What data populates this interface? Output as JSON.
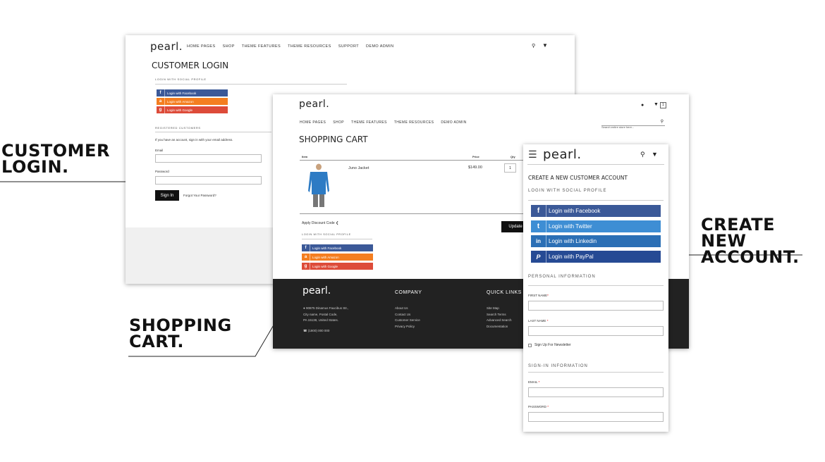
{
  "callouts": {
    "login": [
      "CUSTOMER",
      "LOGIN."
    ],
    "cart": [
      "SHOPPING",
      "CART."
    ],
    "account": [
      "CREATE NEW",
      "ACCOUNT."
    ]
  },
  "login_panel": {
    "logo": "pearl.",
    "nav": [
      "HOME PAGES",
      "SHOP",
      "THEME FEATURES",
      "THEME RESOURCES",
      "SUPPORT",
      "DEMO ADMIN"
    ],
    "title": "CUSTOMER LOGIN",
    "social_heading": "LOGIN WITH SOCIAL PROFILE",
    "social": [
      {
        "icon": "f",
        "label": "Login with Facebook"
      },
      {
        "icon": "a",
        "label": "Login with Amazon"
      },
      {
        "icon": "g",
        "label": "Login with Google"
      }
    ],
    "registered_heading": "REGISTERED CUSTOMERS",
    "registered_text": "If you have an account, sign in with your email address.",
    "email_label": "Email",
    "password_label": "Password",
    "sign_in": "Sign In",
    "forgot": "Forgot Your Password?"
  },
  "cart_panel": {
    "logo": "pearl.",
    "cart_count": "1",
    "nav": [
      "HOME PAGES",
      "SHOP",
      "THEME FEATURES",
      "THEME RESOURCES",
      "DEMO ADMIN"
    ],
    "search_placeholder": "Search entire store here...",
    "title": "SHOPPING CART",
    "col_item": "Item",
    "col_price": "Price",
    "col_qty": "Qty",
    "product_name": "Juno Jacket",
    "product_price": "$149.00",
    "product_qty": "1",
    "discount": "Apply Discount Code",
    "update": "Update",
    "social_heading": "LOGIN WITH SOCIAL PROFILE",
    "social": [
      {
        "icon": "f",
        "label": "Login with Facebook"
      },
      {
        "icon": "a",
        "label": "Login with Amazon"
      },
      {
        "icon": "g",
        "label": "Login with Google"
      }
    ],
    "footer": {
      "logo": "pearl.",
      "address": [
        "90875 Dinamus Faucibus Str.,",
        "City name, Postal Code,",
        "PA 15138, United States."
      ],
      "phone": "(1800) 000 000",
      "company_heading": "COMPANY",
      "company_links": [
        "About Us",
        "Contact Us",
        "Customer Service",
        "Privacy Policy"
      ],
      "quick_heading": "QUICK LINKS",
      "quick_links": [
        "Site Map",
        "Search Terms",
        "Advanced Search",
        "Documentation"
      ]
    }
  },
  "account_panel": {
    "logo": "pearl.",
    "title": "CREATE A NEW CUSTOMER ACCOUNT",
    "social_heading": "LOGIN WITH SOCIAL PROFILE",
    "social": [
      {
        "icon": "f",
        "label": "Login with Facebook"
      },
      {
        "icon": "t",
        "label": "Login with Twitter"
      },
      {
        "icon": "in",
        "label": "Login with Linkedin"
      },
      {
        "icon": "P",
        "label": "Login with PayPal"
      }
    ],
    "personal_heading": "PERSONAL INFORMATION",
    "first_name": "FIRST NAME",
    "last_name": "LAST NAME",
    "newsletter": "Sign Up For Newsletter",
    "signin_heading": "SIGN-IN INFORMATION",
    "email": "EMAIL",
    "password": "PASSWORD"
  }
}
